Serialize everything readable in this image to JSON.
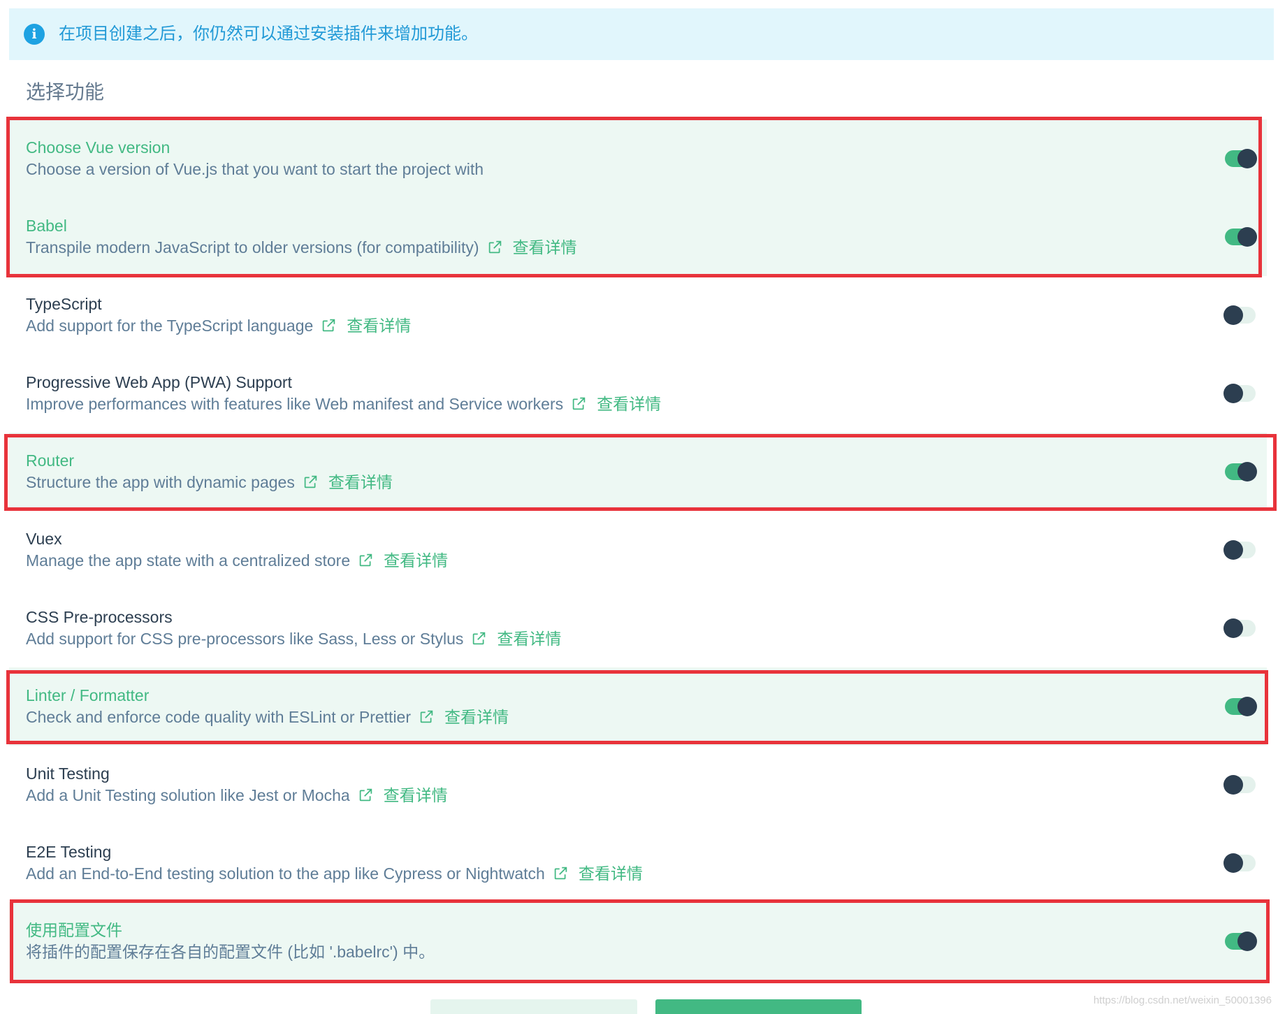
{
  "info_banner": {
    "icon": "info-icon",
    "text": "在项目创建之后，你仍然可以通过安装插件来增加功能。"
  },
  "section_title": "选择功能",
  "features": [
    {
      "title": "Choose Vue version",
      "description": "Choose a version of Vue.js that you want to start the project with",
      "enabled": true
    },
    {
      "title": "Babel",
      "description": "Transpile modern JavaScript to older versions (for compatibility)",
      "link": "查看详情",
      "enabled": true
    },
    {
      "title": "TypeScript",
      "description": "Add support for the TypeScript language",
      "link": "查看详情",
      "enabled": false
    },
    {
      "title": "Progressive Web App (PWA) Support",
      "description": "Improve performances with features like Web manifest and Service workers",
      "link": "查看详情",
      "enabled": false
    },
    {
      "title": "Router",
      "description": "Structure the app with dynamic pages",
      "link": "查看详情",
      "enabled": true
    },
    {
      "title": "Vuex",
      "description": "Manage the app state with a centralized store",
      "link": "查看详情",
      "enabled": false
    },
    {
      "title": "CSS Pre-processors",
      "description": "Add support for CSS pre-processors like Sass, Less or Stylus",
      "link": "查看详情",
      "enabled": false
    },
    {
      "title": "Linter / Formatter",
      "description": "Check and enforce code quality with ESLint or Prettier",
      "link": "查看详情",
      "enabled": true
    },
    {
      "title": "Unit Testing",
      "description": "Add a Unit Testing solution like Jest or Mocha",
      "link": "查看详情",
      "enabled": false
    },
    {
      "title": "E2E Testing",
      "description": "Add an End-to-End testing solution to the app like Cypress or Nightwatch",
      "link": "查看详情",
      "enabled": false
    },
    {
      "title": "使用配置文件",
      "description": "将插件的配置保存在各自的配置文件 (比如 '.babelrc') 中。",
      "enabled": true
    }
  ],
  "link_icon": "external-link-icon",
  "watermark": "https://blog.csdn.net/weixin_50001396",
  "colors": {
    "accent": "#42b983",
    "dark": "#2c3e50",
    "info": "#1ea2e2",
    "info_text": "#2199d6",
    "banner_bg": "#e1f6fc",
    "selected_bg": "#edf8f3",
    "annotation": "#e8333b"
  }
}
